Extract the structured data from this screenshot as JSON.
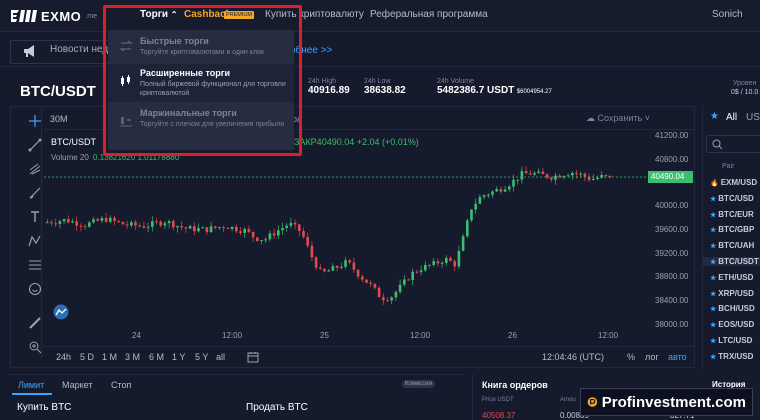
{
  "nav": {
    "logo": "EXMO",
    "logo_sub": ".me",
    "trade": "Торги",
    "cashback": "Cashback",
    "premium": "PREMIUM",
    "buy_crypto": "Купить криптовалюту",
    "referral": "Реферальная программа",
    "user": "Sonich"
  },
  "news": {
    "text": "Новости нед",
    "link": "обнее >>"
  },
  "market": {
    "pair": "BTC/USDT",
    "stats": [
      {
        "label": "24h High",
        "value": "40916.89",
        "sub": ""
      },
      {
        "label": "24h Low",
        "value": "38638.82",
        "sub": ""
      },
      {
        "label": "24h Volume",
        "value": "5482386.7 USDT",
        "sub": "$6004954.27"
      }
    ],
    "right_label": "Уровен",
    "right_value": "0$ / 10.0"
  },
  "dropdown": {
    "items": [
      {
        "title": "Быстрые торги",
        "desc": "Торгуйте криптовалютами в один клик"
      },
      {
        "title": "Расширенные торги",
        "desc": "Полный биржевой функционал для торговли криптовалютой"
      },
      {
        "title": "Маржинальные торги",
        "desc": "Торгуйте с плечом для увеличения прибыли"
      }
    ]
  },
  "chart_toolbar": {
    "timeframe": "30M",
    "save": "Сохранить",
    "partial": "ера"
  },
  "chart_legend": {
    "title": "BTC/USDT",
    "ohlc": "ЗАКР40490.04 +2.04 (+0.01%)",
    "volume_label": "Volume 20",
    "volume_vals": "0.13821620  1.01178880"
  },
  "chart_data": {
    "type": "candlestick",
    "price_axis": [
      "41200.00",
      "40800.00",
      "40400.00",
      "40000.00",
      "39600.00",
      "39200.00",
      "38800.00",
      "38400.00",
      "38000.00"
    ],
    "time_axis": [
      "24",
      "12:00",
      "25",
      "12:00",
      "26",
      "12:00"
    ],
    "last_price": "40490.04",
    "ylim": [
      38000,
      41300
    ]
  },
  "range": {
    "items": [
      "24h",
      "5 D",
      "1 M",
      "3 M",
      "6 M",
      "1 Y",
      "5 Y",
      "all"
    ],
    "clock": "12:04:46 (UTC)",
    "pct": "%",
    "log": "лог",
    "auto": "авто"
  },
  "markets": {
    "all": "All",
    "usd": "US",
    "pair_header": "Pair",
    "pairs": [
      "EXM/USD",
      "BTC/USD",
      "BTC/EUR",
      "BTC/GBP",
      "BTC/UAH",
      "BTC/USDT",
      "ETH/USD",
      "XRP/USD",
      "BCH/USD",
      "EOS/USD",
      "LTC/USD",
      "TRX/USD"
    ]
  },
  "order": {
    "tabs": [
      "Лимит",
      "Маркет",
      "Стоп"
    ],
    "commission": "Комиссии",
    "buy": "Купить BTC",
    "sell": "Продать BTC"
  },
  "orderbook": {
    "title": "Книга ордеров",
    "price_header": "Price USDT",
    "amount_header": "Amou",
    "row_price": "40508.37",
    "row_amount": "0.00809",
    "row_total": "327.71"
  },
  "history": {
    "title": "История тор"
  },
  "watermark": "Profinvestment.com"
}
